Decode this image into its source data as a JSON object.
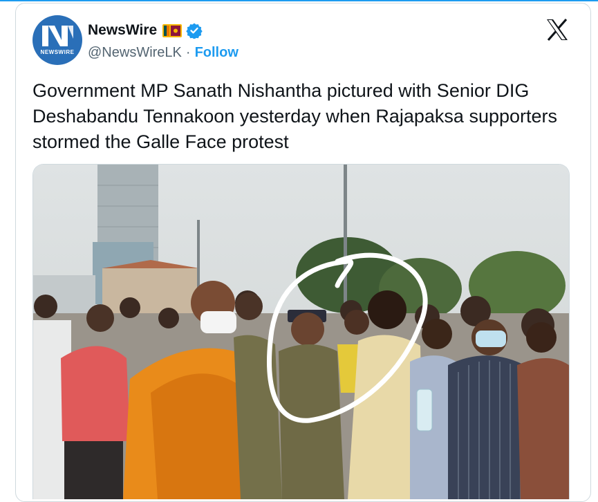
{
  "author": {
    "display_name": "NewsWire",
    "handle": "@NewsWireLK",
    "separator": "·",
    "follow_label": "Follow",
    "avatar_text": "NEWSWIRE"
  },
  "tweet": {
    "text": "Government MP Sanath Nishantha pictured with Senior DIG Deshabandu Tennakoon yesterday when Rajapaksa supporters stormed the Galle Face protest"
  },
  "icons": {
    "platform": "x-logo-icon",
    "verified": "verified-badge-icon",
    "flag": "sri-lanka-flag-icon"
  },
  "colors": {
    "accent": "#1d9bf0",
    "avatar_bg": "#2a6fb8",
    "text": "#0f1419",
    "muted": "#536471",
    "border": "#cfd9de"
  }
}
